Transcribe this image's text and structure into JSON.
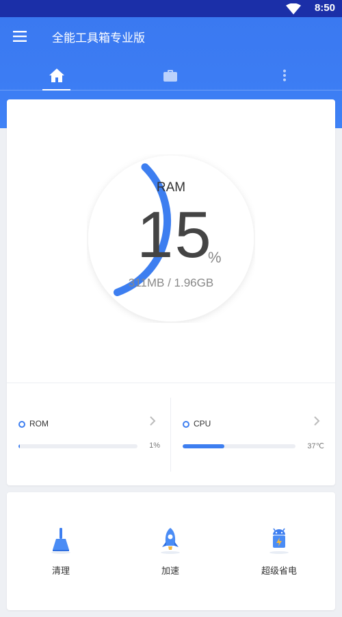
{
  "status_bar": {
    "time": "8:50"
  },
  "toolbar": {
    "title": "全能工具箱专业版"
  },
  "tabs": [
    {
      "icon": "home-icon",
      "selected": true
    },
    {
      "icon": "briefcase-icon",
      "selected": false
    },
    {
      "icon": "more-vertical-icon",
      "selected": false
    }
  ],
  "ram": {
    "label": "RAM",
    "percent": "15",
    "unit": "%",
    "usage": "311MB / 1.96GB",
    "fraction": 0.15
  },
  "stats": {
    "rom": {
      "name": "ROM",
      "value": "1%",
      "fraction": 0.01
    },
    "cpu": {
      "name": "CPU",
      "value": "37℃",
      "fraction": 0.37
    }
  },
  "tools": [
    {
      "label": "清理",
      "icon": "broom-icon"
    },
    {
      "label": "加速",
      "icon": "rocket-icon"
    },
    {
      "label": "超级省电",
      "icon": "android-battery-icon"
    }
  ],
  "colors": {
    "accent": "#3d7ef0",
    "header": "#3c7cf3",
    "status_bar": "#1b2fa8"
  }
}
